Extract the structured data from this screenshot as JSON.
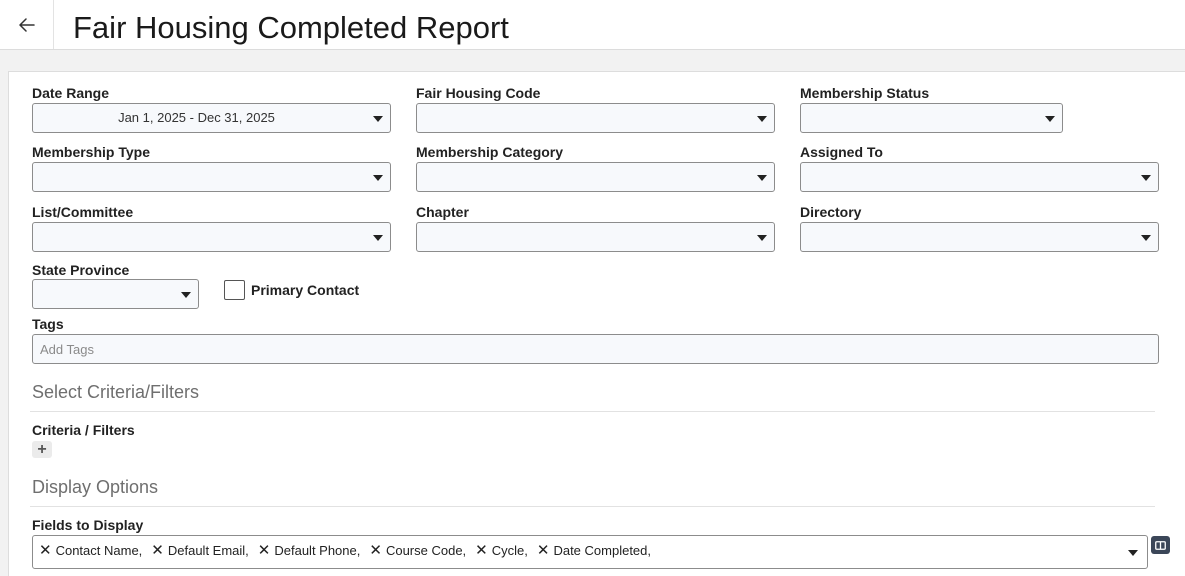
{
  "header": {
    "title": "Fair Housing Completed Report",
    "back_icon": "arrow-left-icon"
  },
  "filters": {
    "date_range": {
      "label": "Date Range",
      "value": "Jan 1, 2025 - Dec 31, 2025"
    },
    "fair_housing_code": {
      "label": "Fair Housing Code",
      "value": ""
    },
    "membership_status": {
      "label": "Membership Status",
      "value": ""
    },
    "membership_type": {
      "label": "Membership Type",
      "value": ""
    },
    "membership_category": {
      "label": "Membership Category",
      "value": ""
    },
    "assigned_to": {
      "label": "Assigned To",
      "value": ""
    },
    "list_committee": {
      "label": "List/Committee",
      "value": ""
    },
    "chapter": {
      "label": "Chapter",
      "value": ""
    },
    "directory": {
      "label": "Directory",
      "value": ""
    },
    "state_province": {
      "label": "State Province",
      "value": ""
    },
    "primary_contact": {
      "label": "Primary Contact",
      "checked": false
    },
    "tags": {
      "label": "Tags",
      "placeholder": "Add Tags",
      "value": ""
    }
  },
  "criteria": {
    "section_title": "Select Criteria/Filters",
    "label": "Criteria / Filters",
    "add_label": "+"
  },
  "display": {
    "section_title": "Display Options",
    "fields_label": "Fields to Display",
    "fields": [
      "Contact Name,",
      "Default Email,",
      "Default Phone,",
      "Course Code,",
      "Cycle,",
      "Date Completed,"
    ],
    "remove_glyph": "✕"
  },
  "colors": {
    "accent_dark": "#3b4658",
    "border": "#8c8c8c",
    "field_bg": "#f7f9fc"
  }
}
